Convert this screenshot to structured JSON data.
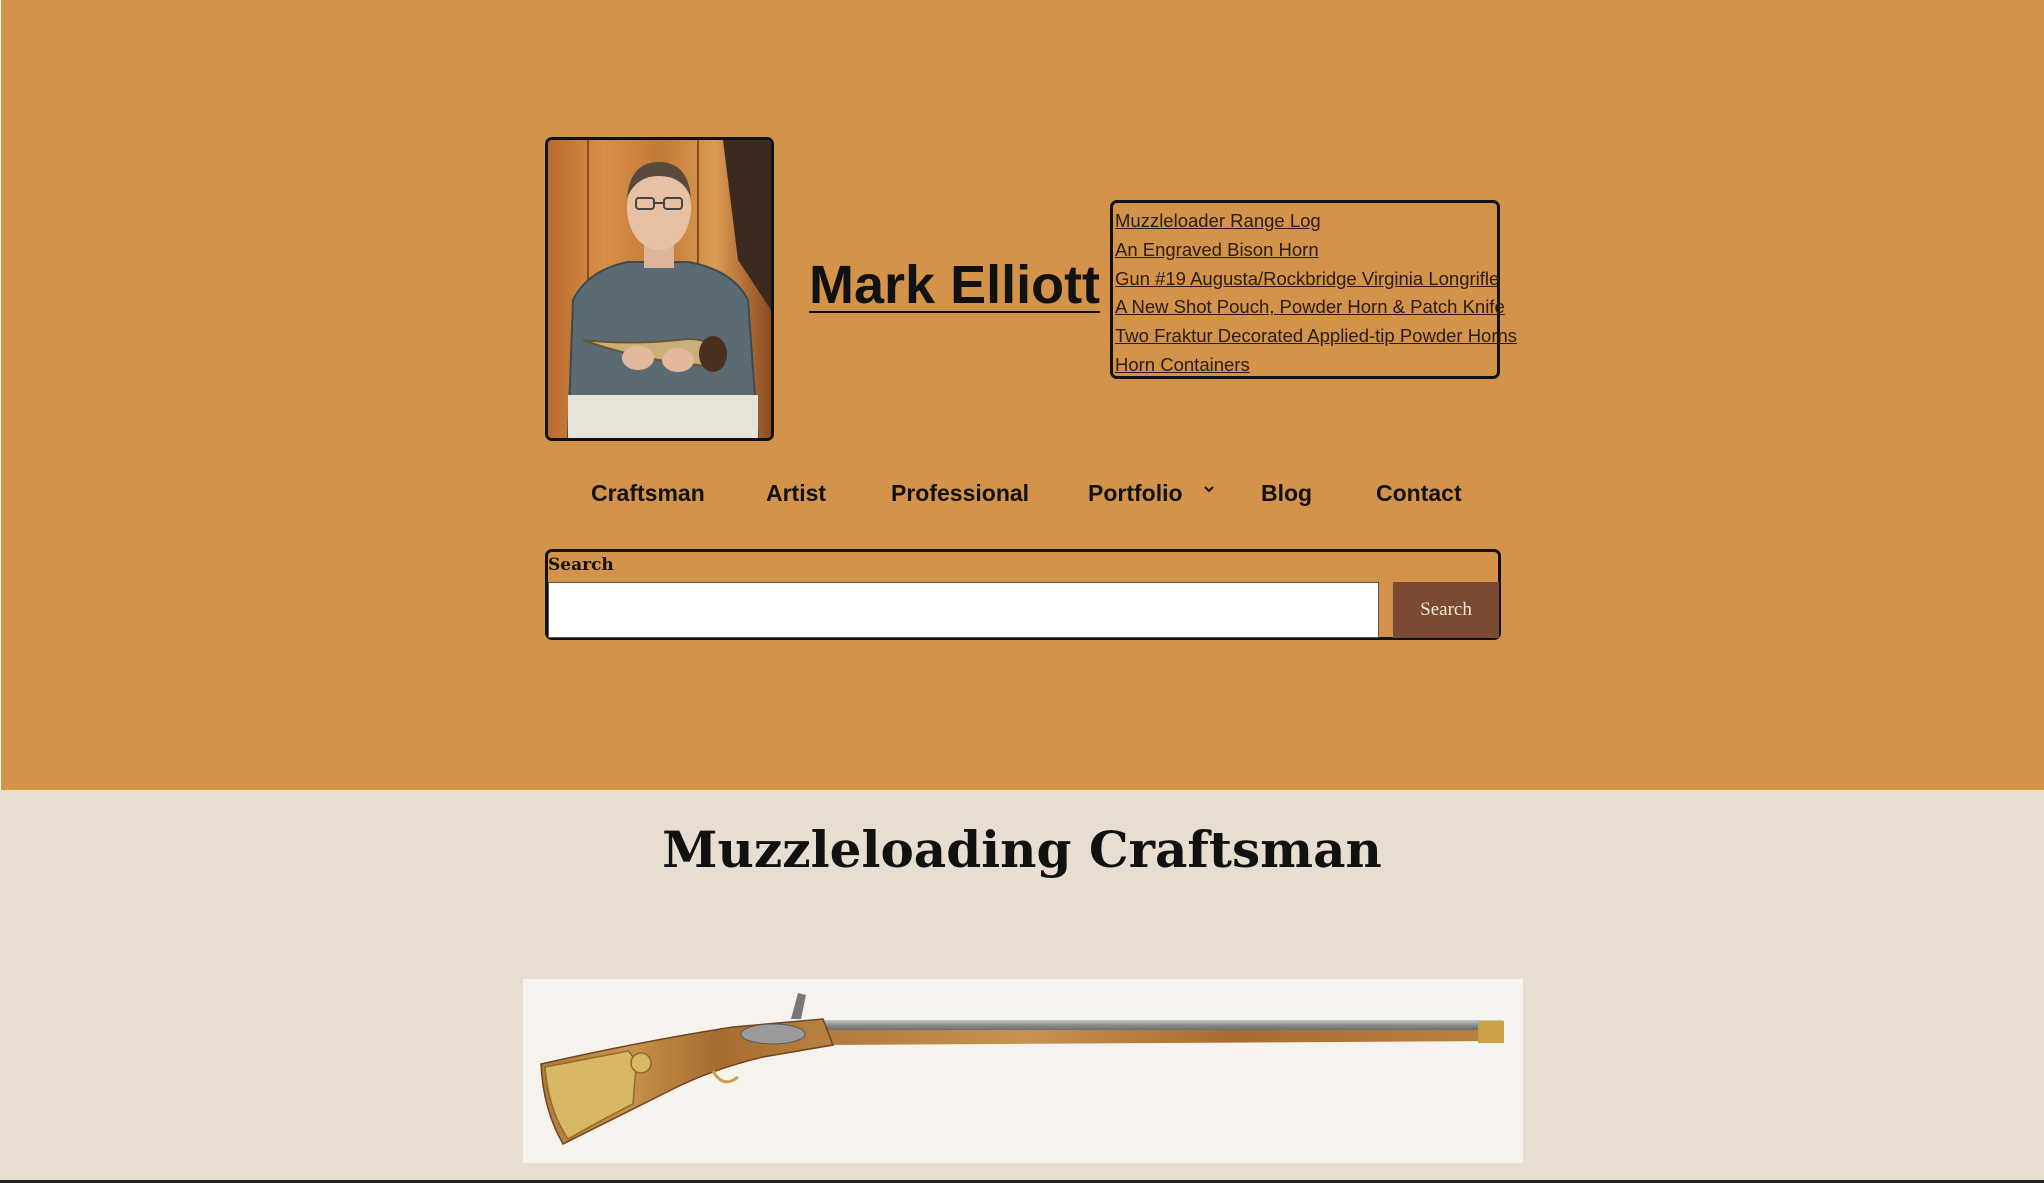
{
  "site": {
    "title": "Mark Elliott"
  },
  "latest_posts": [
    "Muzzleloader Range Log",
    "An Engraved Bison Horn",
    "Gun #19 Augusta/Rockbridge Virginia Longrifle",
    "A New Shot Pouch, Powder Horn & Patch Knife",
    "Two Fraktur Decorated Applied-tip Powder Horns",
    "Horn Containers"
  ],
  "nav": {
    "items": [
      "Craftsman",
      "Artist",
      "Professional",
      "Portfolio",
      "Blog",
      "Contact"
    ],
    "portfolio_has_submenu": true
  },
  "search": {
    "label": "Search",
    "value": "",
    "button_label": "Search"
  },
  "page": {
    "heading": "Muzzleloading Craftsman"
  },
  "colors": {
    "header_background": "#d4934a",
    "page_background": "#e8ddd1",
    "search_button": "#7a4a32"
  },
  "icons": {
    "submenu": "chevron-down-icon"
  }
}
